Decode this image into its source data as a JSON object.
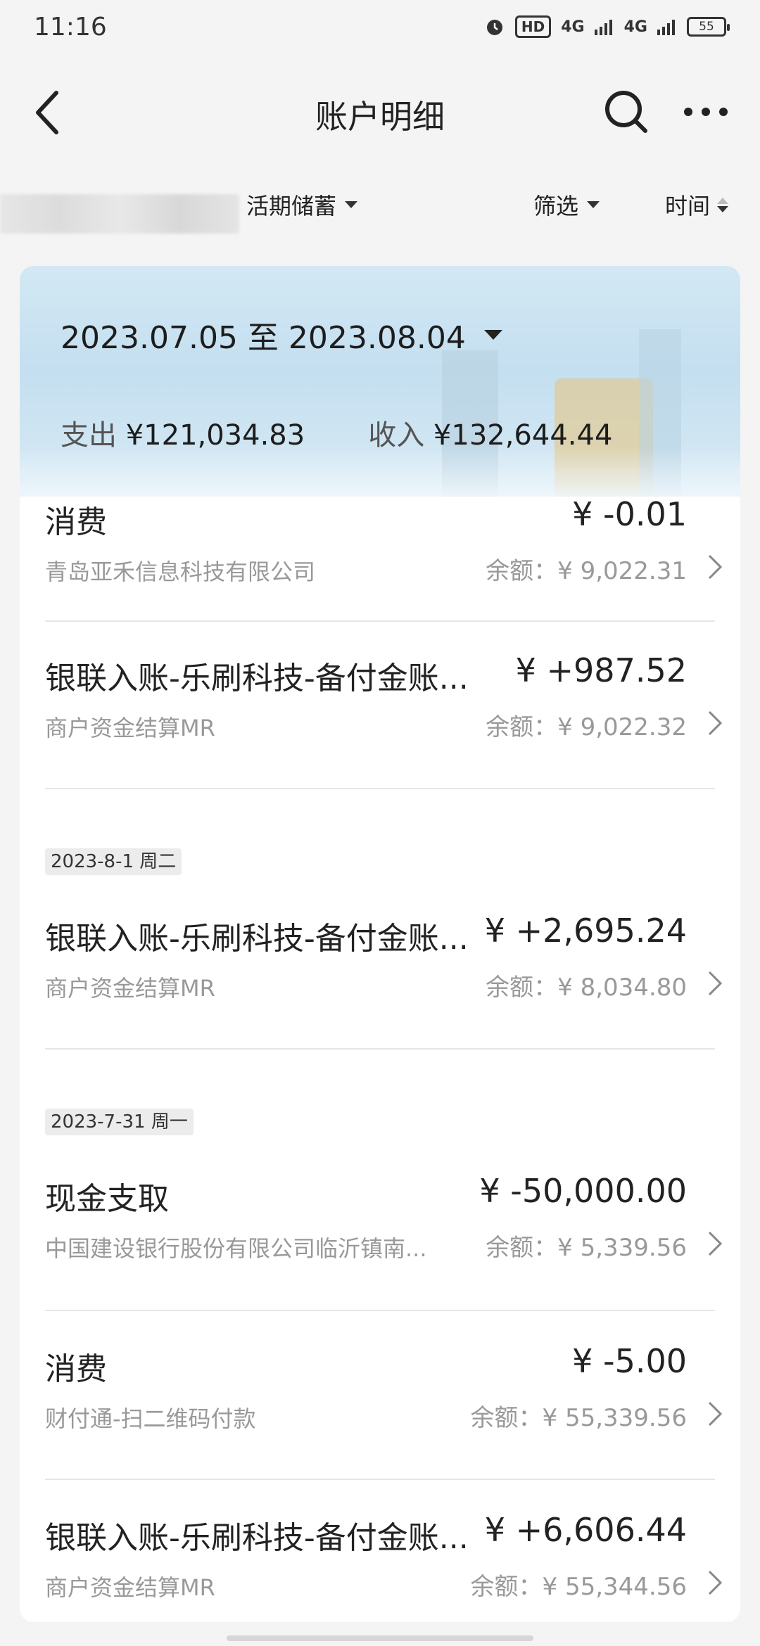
{
  "status_bar": {
    "time": "11:16",
    "hd_label": "HD",
    "network_1": "4G",
    "network_2": "4G",
    "battery": "55"
  },
  "header": {
    "title": "账户明细"
  },
  "filters": {
    "account_label": "活期储蓄",
    "filter_label": "筛选",
    "time_label": "时间"
  },
  "summary": {
    "date_range": "2023.07.05 至 2023.08.04",
    "expense_label": "支出",
    "expense_amount": "¥121,034.83",
    "income_label": "收入",
    "income_amount": "¥132,644.44"
  },
  "transactions": [
    {
      "title": "消费",
      "amount": "¥ -0.01",
      "subtitle": "青岛亚禾信息科技有限公司",
      "balance": "余额：¥ 9,022.31"
    },
    {
      "title": "银联入账-乐刷科技-备付金账...",
      "amount": "¥ +987.52",
      "subtitle": "商户资金结算MR",
      "balance": "余额：¥ 9,022.32"
    },
    {
      "date": "2023-8-1 周二",
      "title": "银联入账-乐刷科技-备付金账...",
      "amount": "¥ +2,695.24",
      "subtitle": "商户资金结算MR",
      "balance": "余额：¥ 8,034.80"
    },
    {
      "date": "2023-7-31 周一",
      "title": "现金支取",
      "amount": "¥ -50,000.00",
      "subtitle": "中国建设银行股份有限公司临沂镇南...",
      "balance": "余额：¥ 5,339.56"
    },
    {
      "title": "消费",
      "amount": "¥ -5.00",
      "subtitle": "财付通-扫二维码付款",
      "balance": "余额：¥ 55,339.56"
    },
    {
      "title": "银联入账-乐刷科技-备付金账...",
      "amount": "¥ +6,606.44",
      "subtitle": "商户资金结算MR",
      "balance": "余额：¥ 55,344.56"
    }
  ],
  "icons": {
    "back": "chevron-left-icon",
    "search": "search-icon",
    "more": "more-dots-icon",
    "row_arrow": "chevron-right-icon"
  }
}
